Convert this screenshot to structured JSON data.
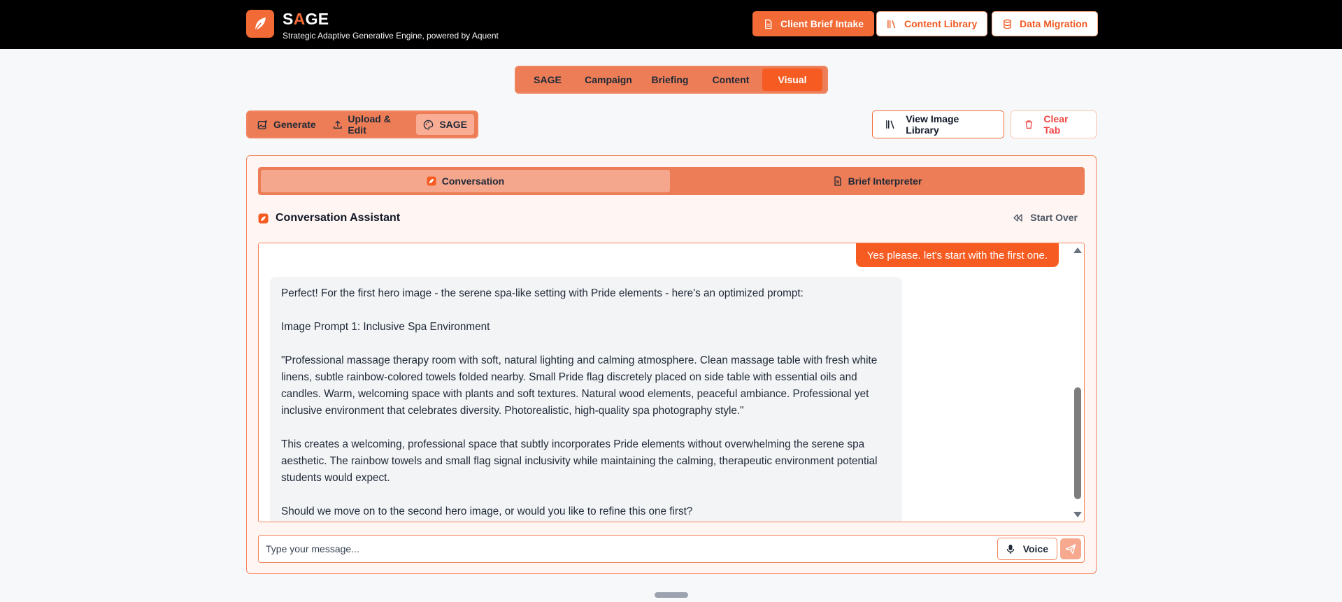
{
  "header": {
    "brand_prefix": "S",
    "brand_highlight": "A",
    "brand_suffix": "GE",
    "tagline": "Strategic Adaptive Generative Engine, powered by Aquent",
    "buttons": {
      "client_brief": "Client Brief Intake",
      "content_library": "Content Library",
      "data_migration": "Data Migration"
    }
  },
  "main_tabs": [
    "SAGE",
    "Campaign",
    "Briefing",
    "Content",
    "Visual"
  ],
  "main_tabs_active": "Visual",
  "sub_tabs": [
    "Generate",
    "Upload & Edit",
    "SAGE"
  ],
  "sub_tabs_active": "SAGE",
  "actions": {
    "view_library": "View Image Library",
    "clear_tab": "Clear Tab"
  },
  "inner_tabs": [
    "Conversation",
    "Brief Interpreter"
  ],
  "inner_tabs_active": "Conversation",
  "assistant": {
    "title": "Conversation Assistant",
    "start_over": "Start Over"
  },
  "messages": {
    "user": "Yes please. let's start with the first one.",
    "bot_paragraphs": [
      "Perfect! For the first hero image - the serene spa-like setting with Pride elements - here's an optimized prompt:",
      "Image Prompt 1: Inclusive Spa Environment",
      "\"Professional massage therapy room with soft, natural lighting and calming atmosphere. Clean massage table with fresh white linens, subtle rainbow-colored towels folded nearby. Small Pride flag discretely placed on side table with essential oils and candles. Warm, welcoming space with plants and soft textures. Natural wood elements, peaceful ambiance. Professional yet inclusive environment that celebrates diversity. Photorealistic, high-quality spa photography style.\"",
      "This creates a welcoming, professional space that subtly incorporates Pride elements without overwhelming the serene spa aesthetic. The rainbow towels and small flag signal inclusivity while maintaining the calming, therapeutic environment potential students would expect.",
      "Should we move on to the second hero image, or would you like to refine this one first?"
    ]
  },
  "composer": {
    "placeholder": "Type your message...",
    "value": "",
    "voice_label": "Voice"
  },
  "colors": {
    "accent": "#f26a35",
    "accent_strong": "#f65c22",
    "tab_bar": "#ed7d57",
    "panel_bg": "#fff5f2",
    "header_bg": "#000000"
  }
}
